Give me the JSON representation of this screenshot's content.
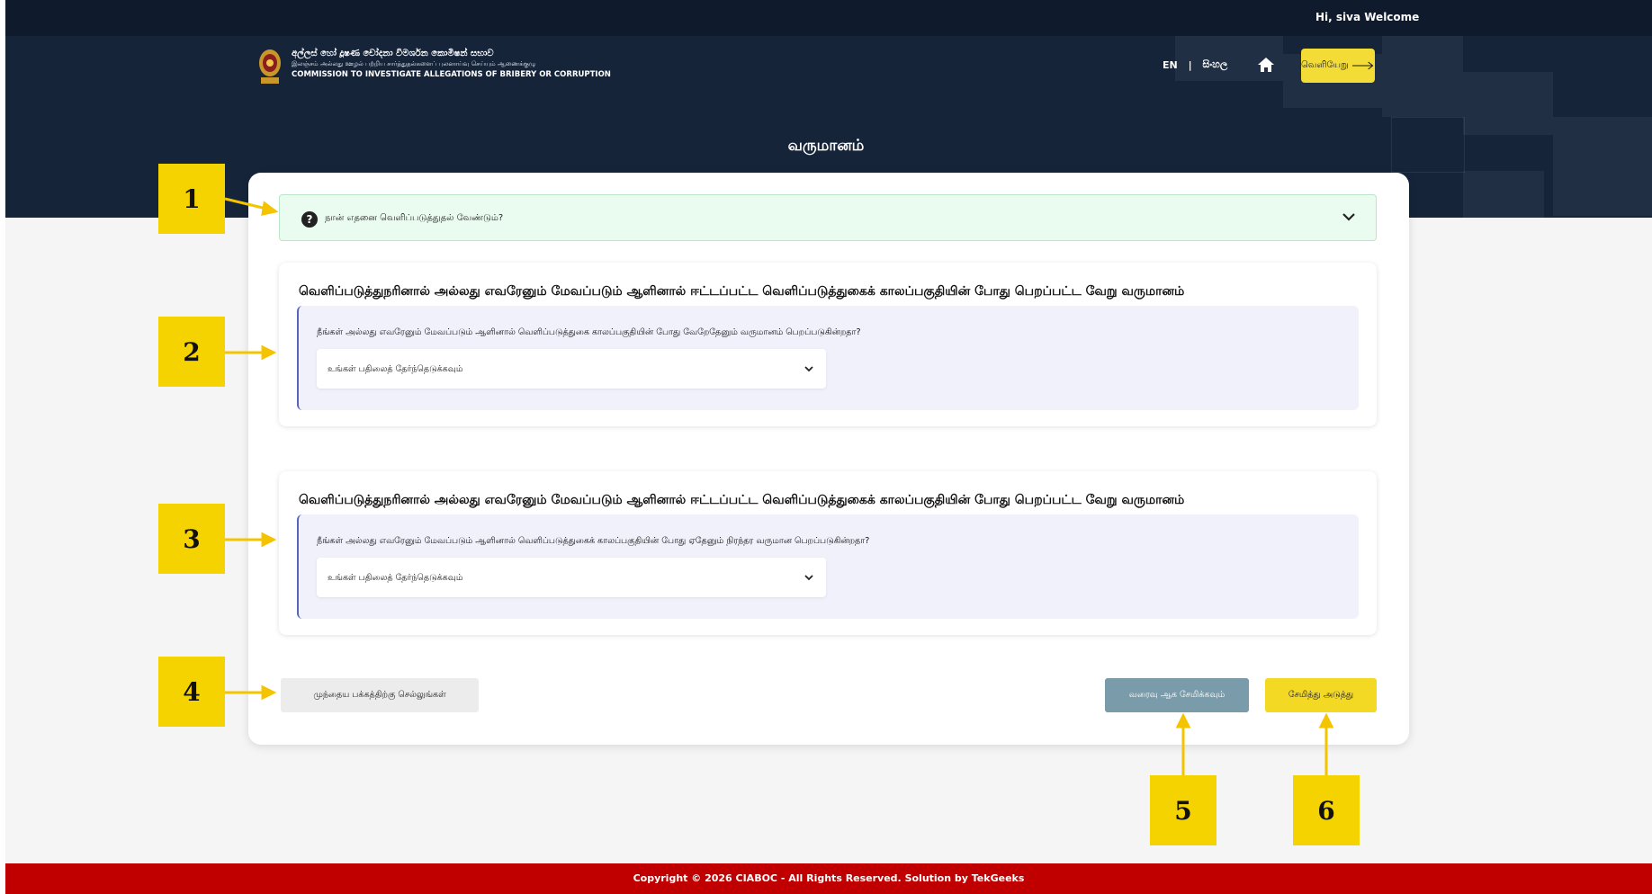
{
  "topbar": {
    "greeting": "Hi, siva Welcome"
  },
  "org": {
    "name_si": "අල්ලස් හෝ දූෂණ චෝදනා විමර්ශන කොමිෂන් සභාව",
    "name_ta": "இலஞ்சம் அல்லது ஊழல் பற்றிய சார்த்துதல்களைப் புலனாய்வு செய்யும் ஆணைக்குழு",
    "name_en": "COMMISSION TO INVESTIGATE ALLEGATIONS OF BRIBERY OR CORRUPTION"
  },
  "nav": {
    "lang_en": "EN",
    "separator": "|",
    "lang_si": "සිංහල",
    "logout_label": "வெளியேறு",
    "logout_icon": "long-arrow-right-icon",
    "home_icon": "home-icon"
  },
  "page": {
    "title": "வருமானம்"
  },
  "faq": {
    "icon": "question-circle-icon",
    "text": "நான் எதனை வெளிப்படுத்துதல் வேண்டும்?",
    "chevron_icon": "chevron-down-icon"
  },
  "sections": [
    {
      "title": "வெளிப்படுத்துநரினால் அல்லது எவரேனும் மேவப்படும் ஆளினால் ஈட்டப்பட்ட வெளிப்படுத்துகைக் காலப்பகுதியின் போது பெறப்பட்ட வேறு வருமானம்",
      "question": "நீங்கள் அல்லது எவரேனும் மேவப்படும் ஆளினால் வெளிப்படுத்துகை காலப்பகுதியின் போது வேறேதேனும் வருமானம் பெறப்படுகின்றதா?",
      "select_value": "உங்கள் பதிலைத் தேர்ந்தெடுக்கவும்"
    },
    {
      "title": "வெளிப்படுத்துநரினால் அல்லது எவரேனும் மேவப்படும் ஆளினால் ஈட்டப்பட்ட வெளிப்படுத்துகைக் காலப்பகுதியின் போது பெறப்பட்ட வேறு வருமானம்",
      "question": "நீங்கள் அல்லது எவரேனும் மேவப்படும் ஆளினால் வெளிப்படுத்துகைக் காலப்பகுதியின் போது ஏதேனும் நிரந்தர வருமான பெறப்படுகின்றதா?",
      "select_value": "உங்கள் பதிலைத் தேர்ந்தெடுக்கவும்"
    }
  ],
  "buttons": {
    "previous": "முந்தைய பக்கத்திற்கு செல்லுங்கள்",
    "save_draft": "வரைவு ஆக சேமிக்கவும்",
    "save_next": "சேமித்து அடுத்து"
  },
  "footer": {
    "text": "Copyright © 2026 CIABOC - All Rights Reserved. Solution by TekGeeks"
  },
  "callouts": [
    "1",
    "2",
    "3",
    "4",
    "5",
    "6"
  ],
  "colors": {
    "header": "#16243a",
    "accent_yellow": "#f4d924",
    "draft_button": "#7a9caa",
    "footer_red": "#c00000",
    "faq_bg": "#eafcef",
    "callout_yellow": "#f5d300"
  }
}
